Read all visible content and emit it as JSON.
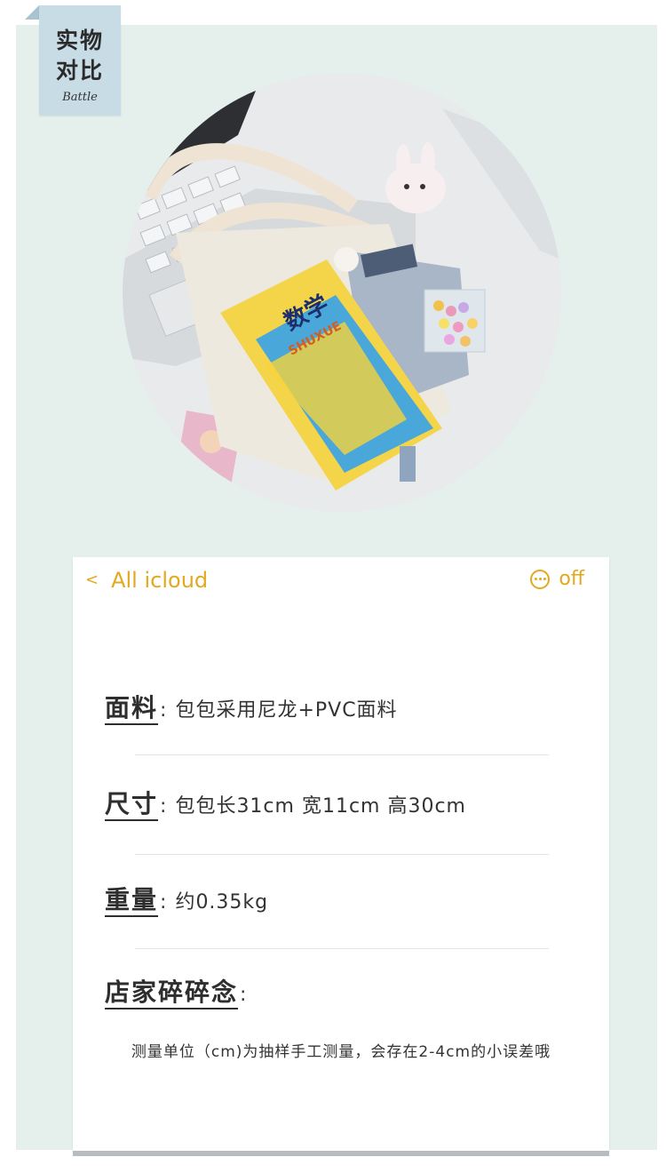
{
  "corner_tag": {
    "line1": "实物",
    "line2": "对比",
    "subtitle": "Battle"
  },
  "photo": {
    "icon": "tote-bag-photo",
    "book_title": "数学",
    "book_pinyin": "SHUXUE"
  },
  "card": {
    "nav": {
      "back_chevron": "<",
      "back_label": "All icloud",
      "more_icon": "ellipsis-circle-icon",
      "right_label": "off"
    },
    "specs": [
      {
        "label": "面料",
        "colon": ":",
        "value": "包包采用尼龙+PVC面料"
      },
      {
        "label": "尺寸",
        "colon": ":",
        "value": "包包长31cm 宽11cm 高30cm"
      },
      {
        "label": "重量",
        "colon": ":",
        "value": "约0.35kg"
      },
      {
        "label": "店家碎碎念",
        "colon": ":",
        "value": ""
      }
    ],
    "note": "测量单位（cm)为抽样手工测量，会存在2-4cm的小误差哦"
  },
  "colors": {
    "panel": "#e5efec",
    "tag": "#c8dce6",
    "accent": "#e4a81f",
    "text": "#333333"
  }
}
